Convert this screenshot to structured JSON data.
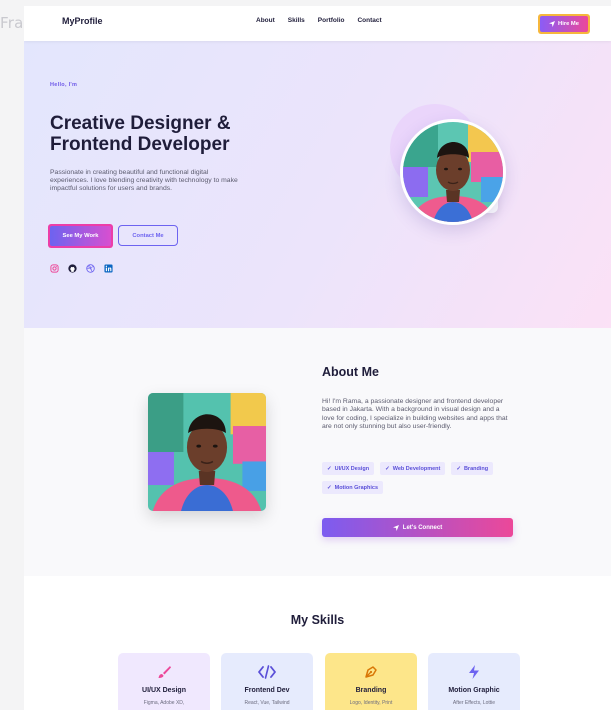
{
  "frame_label": "Frame",
  "nav": {
    "brand": "MyProfile",
    "links": [
      "About",
      "Skills",
      "Portfolio",
      "Contact"
    ],
    "hire_label": "Hire Me"
  },
  "hero": {
    "greeting": "Hello, I'm",
    "title_line1": "Creative Designer &",
    "title_line2": "Frontend Developer",
    "description": "Passionate in creating beautiful and functional digital experiences. I love blending creativity with technology to make impactful solutions for users and brands.",
    "primary_button": "See My Work",
    "secondary_button": "Contact Me",
    "socials": [
      "instagram-icon",
      "github-icon",
      "dribbble-icon",
      "linkedin-icon"
    ]
  },
  "about": {
    "title": "About Me",
    "text": "Hi! I'm Rama, a passionate designer and frontend developer based in Jakarta. With a background in visual design and a love for coding, I specialize in building websites and apps that are not only stunning but also user-friendly.",
    "tags": [
      "UI/UX Design",
      "Web Development",
      "Branding",
      "Motion Graphics"
    ],
    "connect_button": "Let's Connect"
  },
  "skills": {
    "title": "My Skills",
    "cards": [
      {
        "name": "UI/UX Design",
        "desc": "Figma, Adobe XD,",
        "bg": "#f0e8fe",
        "icon": "brush-icon",
        "icon_color": "#ec4899"
      },
      {
        "name": "Frontend Dev",
        "desc": "React, Vue, Tailwind",
        "bg": "#e6ebfd",
        "icon": "code-icon",
        "icon_color": "#5a4fd8"
      },
      {
        "name": "Branding",
        "desc": "Logo, Identity, Print",
        "bg": "#fde68a",
        "icon": "pen-nib-icon",
        "icon_color": "#d97706"
      },
      {
        "name": "Motion Graphic",
        "desc": "After Effects, Lottie",
        "bg": "#e6ebfd",
        "icon": "lightning-icon",
        "icon_color": "#6d63f0"
      }
    ]
  },
  "colors": {
    "accent_purple": "#6d63f0",
    "accent_pink": "#ec4899",
    "hire_outline": "#f6b73c"
  }
}
